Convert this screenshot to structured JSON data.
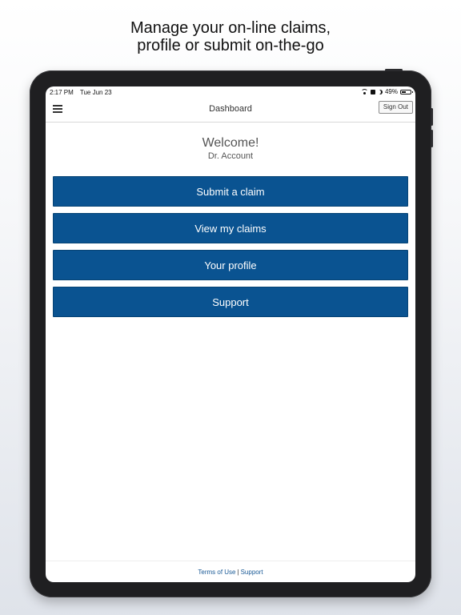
{
  "marketing": {
    "line1": "Manage your on-line claims,",
    "line2": "profile or submit on-the-go"
  },
  "status_bar": {
    "time": "2:17 PM",
    "date": "Tue Jun 23",
    "battery": "49%",
    "battery_level": 0.49,
    "icons": [
      "wifi-icon",
      "lock-icon",
      "moon-icon",
      "battery-icon"
    ]
  },
  "nav": {
    "title": "Dashboard",
    "sign_out_label": "Sign Out",
    "menu_icon": "hamburger-menu-icon"
  },
  "welcome": {
    "title": "Welcome!",
    "name": "Dr. Account"
  },
  "actions": [
    {
      "label": "Submit a claim"
    },
    {
      "label": "View my claims"
    },
    {
      "label": "Your profile"
    },
    {
      "label": "Support"
    }
  ],
  "footer": {
    "terms_label": "Terms of Use",
    "separator": "|",
    "support_label": "Support"
  },
  "colors": {
    "primary_button": "#0a5391",
    "link": "#1a5a96",
    "device_frame": "#1f1f21"
  }
}
